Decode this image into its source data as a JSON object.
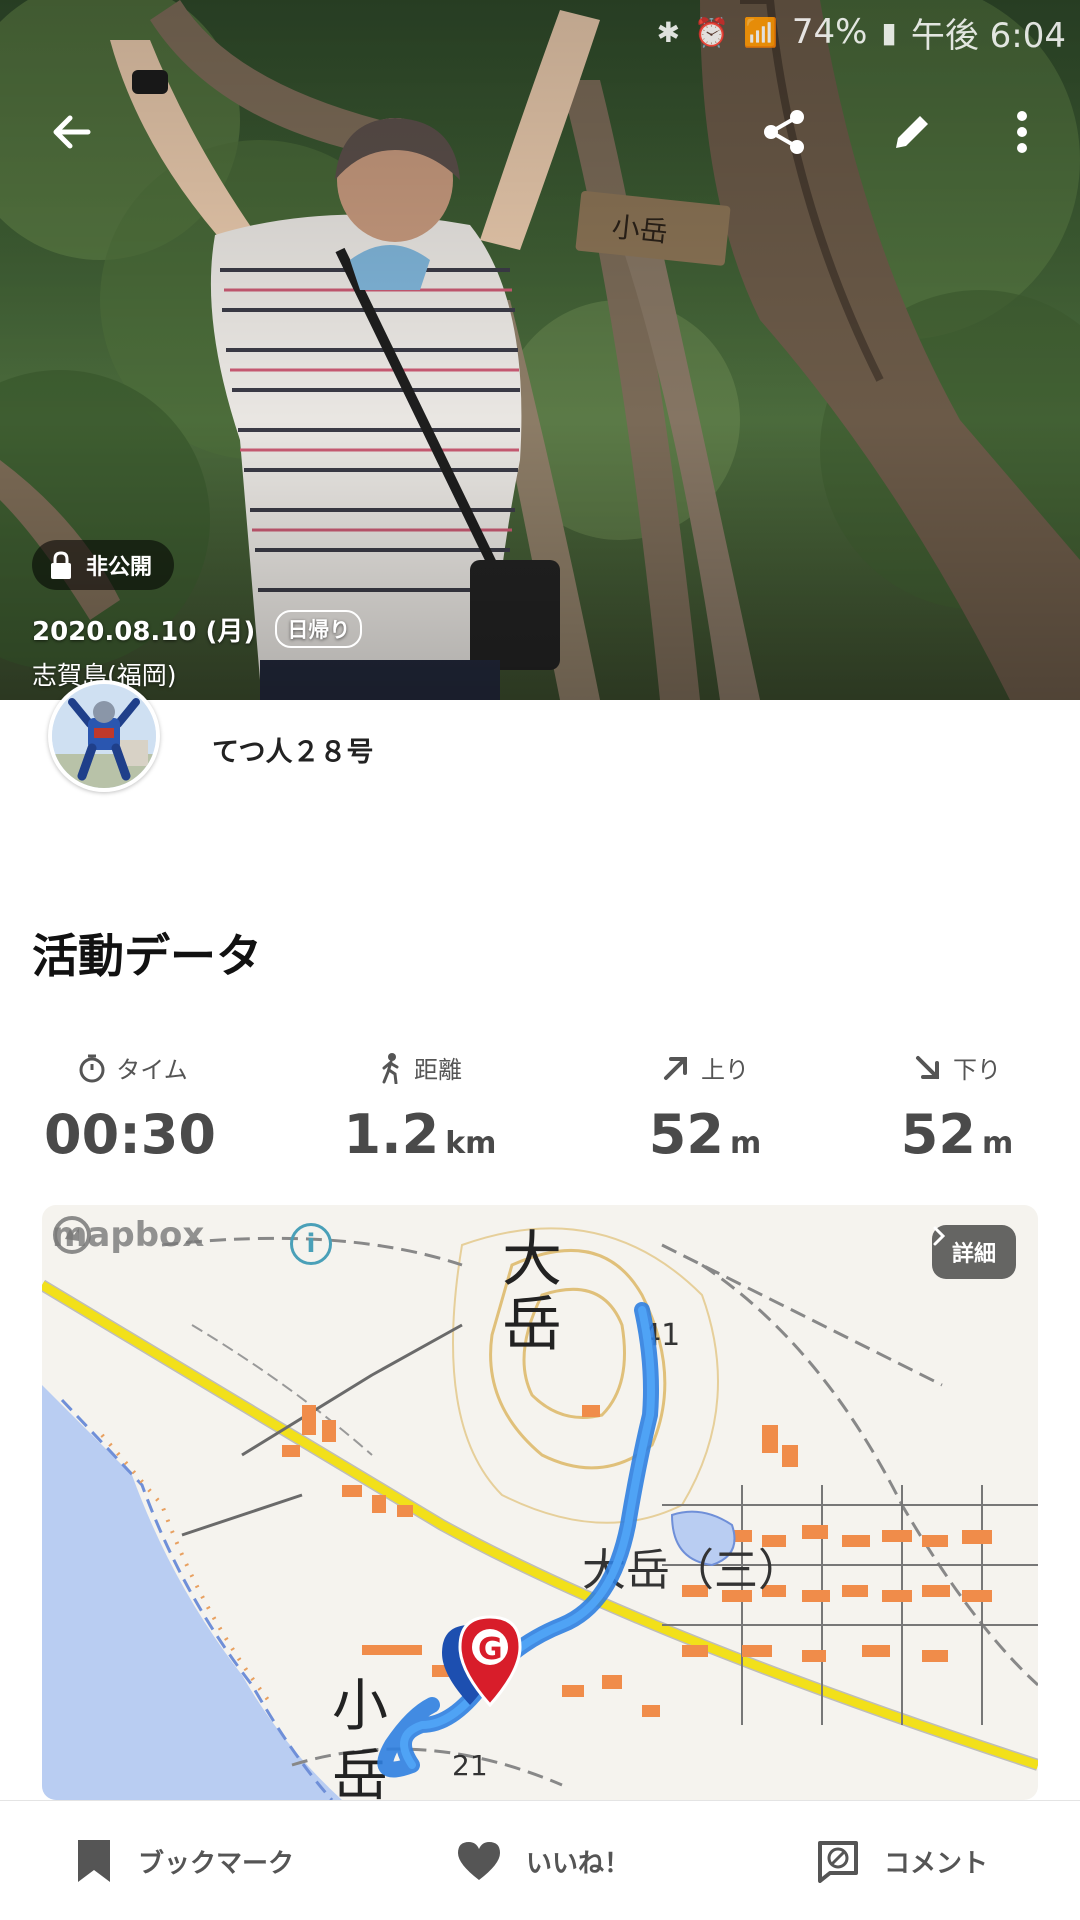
{
  "status_bar": {
    "battery": "74%",
    "time": "午後 6:04"
  },
  "header": {
    "visibility_badge": "非公開",
    "date": "2020.08.10 (月)",
    "trip_type": "日帰り",
    "location": "志賀島(福岡)"
  },
  "user": {
    "name": "てつ人２８号"
  },
  "activity": {
    "title": "活動データ",
    "stats": [
      {
        "icon": "stopwatch-icon",
        "label": "タイム",
        "value": "00:30",
        "unit": ""
      },
      {
        "icon": "hiker-icon",
        "label": "距離",
        "value": "1.2",
        "unit": "km"
      },
      {
        "icon": "arrow-up-right-icon",
        "label": "上り",
        "value": "52",
        "unit": "m"
      },
      {
        "icon": "arrow-down-right-icon",
        "label": "下り",
        "value": "52",
        "unit": "m"
      }
    ]
  },
  "map": {
    "attribution": "mapbox",
    "detail_button": "詳細",
    "labels": {
      "mountain_main": "大岳",
      "mountain_small": "小岳",
      "area": "大岳（三）",
      "elevation_top": "41",
      "elevation_bottom": "21",
      "goal_marker": "G"
    }
  },
  "bottom_bar": {
    "bookmark": "ブックマーク",
    "like": "いいね！",
    "comment": "コメント"
  }
}
